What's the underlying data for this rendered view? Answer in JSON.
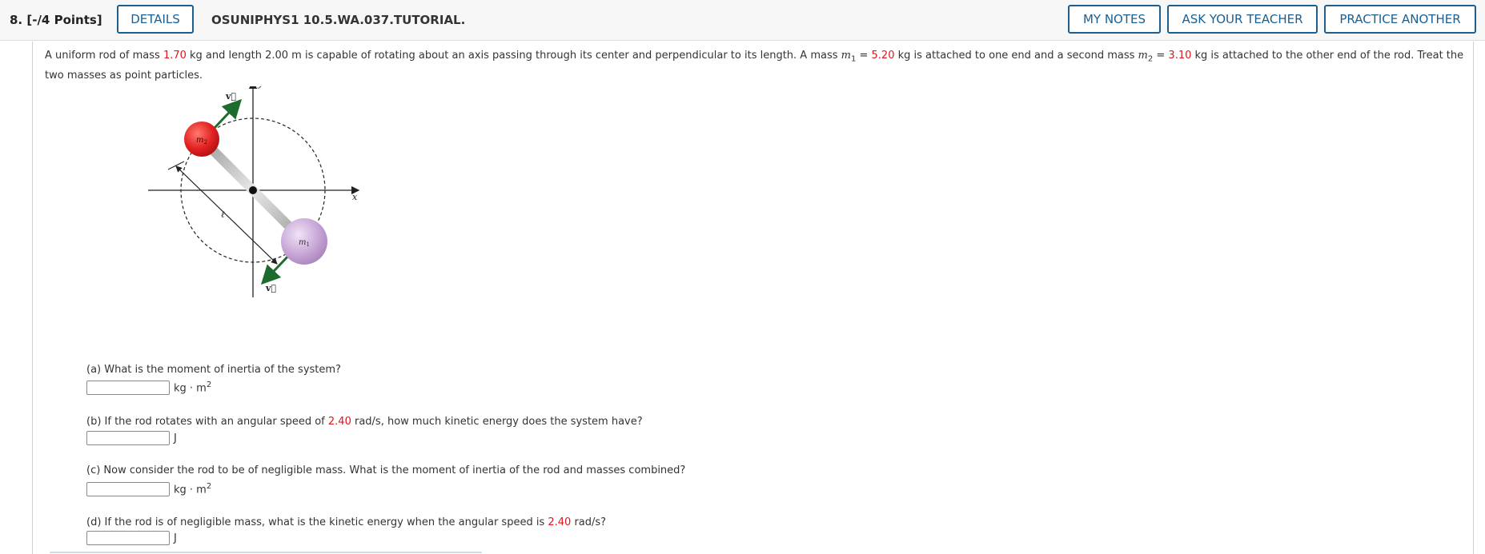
{
  "header": {
    "number_points": "8.  [-/4 Points]",
    "details_label": "DETAILS",
    "title": "OSUNIPHYS1 10.5.WA.037.TUTORIAL.",
    "my_notes_label": "MY NOTES",
    "ask_teacher_label": "ASK YOUR TEACHER",
    "practice_label": "PRACTICE ANOTHER"
  },
  "problem": {
    "t1": "A uniform rod of mass ",
    "rod_mass": "1.70",
    "t2": " kg and length 2.00 m is capable of rotating about an axis passing through its center and perpendicular to its length. A mass ",
    "m1_sym": "m",
    "m1_sub": "1",
    "t3": " = ",
    "m1_val": "5.20",
    "t4": " kg is attached to one end and a second mass ",
    "m2_sym": "m",
    "m2_sub": "2",
    "t5": " = ",
    "m2_val": "3.10",
    "t6": " kg is attached to the other end of the rod. Treat the two masses as point particles."
  },
  "figure": {
    "y_label": "y",
    "x_label": "x",
    "m1_label": "m",
    "m1_sub": "1",
    "m2_label": "m",
    "m2_sub": "2",
    "length_label": "ℓ",
    "v_label": "v⃗",
    "colors": {
      "m1": "#c9a8d8",
      "m2": "#e32222",
      "arrow": "#1e6b2e"
    }
  },
  "parts": {
    "a_question": "(a) What is the moment of inertia of the system?",
    "a_unit": "kg · m",
    "a_unit_exp": "2",
    "b_q1": "(b) If the rod rotates with an angular speed of ",
    "b_speed": "2.40",
    "b_q2": " rad/s, how much kinetic energy does the system have?",
    "b_unit": "J",
    "c_question": "(c) Now consider the rod to be of negligible mass. What is the moment of inertia of the rod and masses combined?",
    "c_unit": "kg · m",
    "c_unit_exp": "2",
    "d_q1": "(d) If the rod is of negligible mass, what is the kinetic energy when the angular speed is ",
    "d_speed": "2.40",
    "d_q2": " rad/s?",
    "d_unit": "J"
  },
  "colors": {
    "accent": "#1a5f8f",
    "highlight": "#e0141e"
  }
}
